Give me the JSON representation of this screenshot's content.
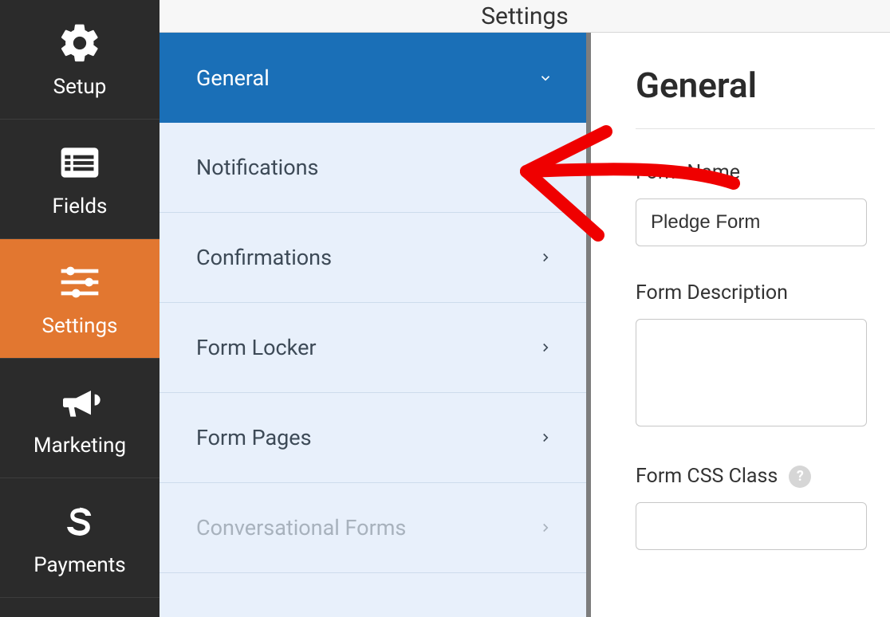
{
  "sidebar": {
    "items": [
      {
        "label": "Setup",
        "icon": "gear"
      },
      {
        "label": "Fields",
        "icon": "list"
      },
      {
        "label": "Settings",
        "icon": "sliders",
        "active": true
      },
      {
        "label": "Marketing",
        "icon": "bullhorn"
      },
      {
        "label": "Payments",
        "icon": "dollar"
      }
    ]
  },
  "topbar": {
    "title": "Settings"
  },
  "submenu": {
    "items": [
      {
        "label": "General",
        "active": true,
        "expanded": true
      },
      {
        "label": "Notifications"
      },
      {
        "label": "Confirmations"
      },
      {
        "label": "Form Locker"
      },
      {
        "label": "Form Pages"
      },
      {
        "label": "Conversational Forms",
        "muted": true
      }
    ]
  },
  "content": {
    "heading": "General",
    "form_name_label": "Form Name",
    "form_name_value": "Pledge Form",
    "form_description_label": "Form Description",
    "form_description_value": "",
    "form_css_class_label": "Form CSS Class"
  },
  "annotation": {
    "type": "hand-drawn-arrow",
    "target": "Notifications"
  }
}
